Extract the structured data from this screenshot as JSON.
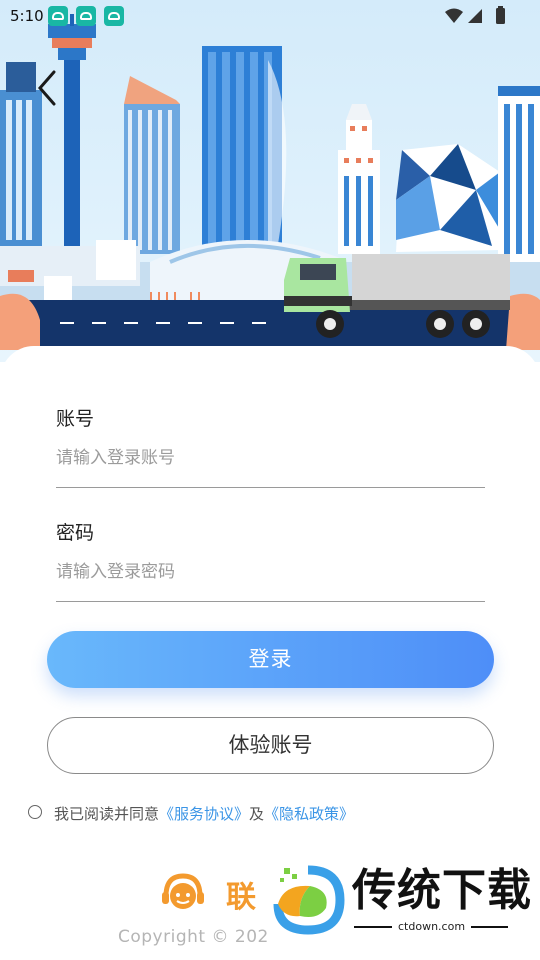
{
  "status_bar": {
    "time": "5:10",
    "app_icons": [
      "car-app-icon",
      "car-app-icon",
      "car-app-icon"
    ],
    "indicators": [
      "wifi-icon",
      "signal-icon",
      "battery-icon"
    ]
  },
  "hero": {
    "back_icon": "chevron-left-icon",
    "illustration": "city-skyline-with-truck"
  },
  "form": {
    "account_label": "账号",
    "account_placeholder": "请输入登录账号",
    "account_value": "",
    "password_label": "密码",
    "password_placeholder": "请输入登录密码",
    "password_value": ""
  },
  "buttons": {
    "login_label": "登录",
    "trial_label": "体验账号"
  },
  "agreement": {
    "checked": false,
    "prefix": "我已阅读并同意",
    "service_link": "《服务协议》",
    "conjunction": "及",
    "privacy_link": "《隐私政策》"
  },
  "footer": {
    "brand_partial": "联",
    "copyright_partial": "Copyright © 202"
  },
  "watermark": {
    "title": "传统下载",
    "url": "ctdown.com"
  },
  "colors": {
    "primary_gradient_start": "#69b8fb",
    "primary_gradient_end": "#4e8ef8",
    "link": "#3b95e6",
    "brand_orange": "#f39a2e",
    "status_app": "#19b7a4"
  }
}
